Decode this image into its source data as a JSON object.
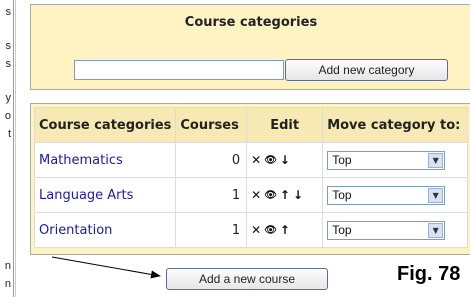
{
  "left_margin_fragments": [
    "s",
    "s",
    "s",
    "y",
    "o",
    "t",
    "n",
    "n"
  ],
  "top_panel": {
    "title": "Course categories",
    "new_category_input": {
      "value": "",
      "placeholder": ""
    },
    "add_category_button": "Add new category"
  },
  "table": {
    "headers": {
      "category": "Course categories",
      "courses": "Courses",
      "edit": "Edit",
      "move": "Move category to:"
    },
    "rows": [
      {
        "name": "Mathematics",
        "courses": "0",
        "icons": [
          "delete-icon",
          "hide-icon",
          "move-down-icon"
        ],
        "move_to": "Top"
      },
      {
        "name": "Language Arts",
        "courses": "1",
        "icons": [
          "delete-icon",
          "hide-icon",
          "move-up-icon",
          "move-down-icon"
        ],
        "move_to": "Top"
      },
      {
        "name": "Orientation",
        "courses": "1",
        "icons": [
          "delete-icon",
          "hide-icon",
          "move-up-icon"
        ],
        "move_to": "Top"
      }
    ]
  },
  "add_course_button": "Add a new course",
  "figure_label": "Fig. 78",
  "colors": {
    "panel_background": "#fff3c4",
    "header_background": "#f6e9b3",
    "link": "#1a1aa6"
  }
}
